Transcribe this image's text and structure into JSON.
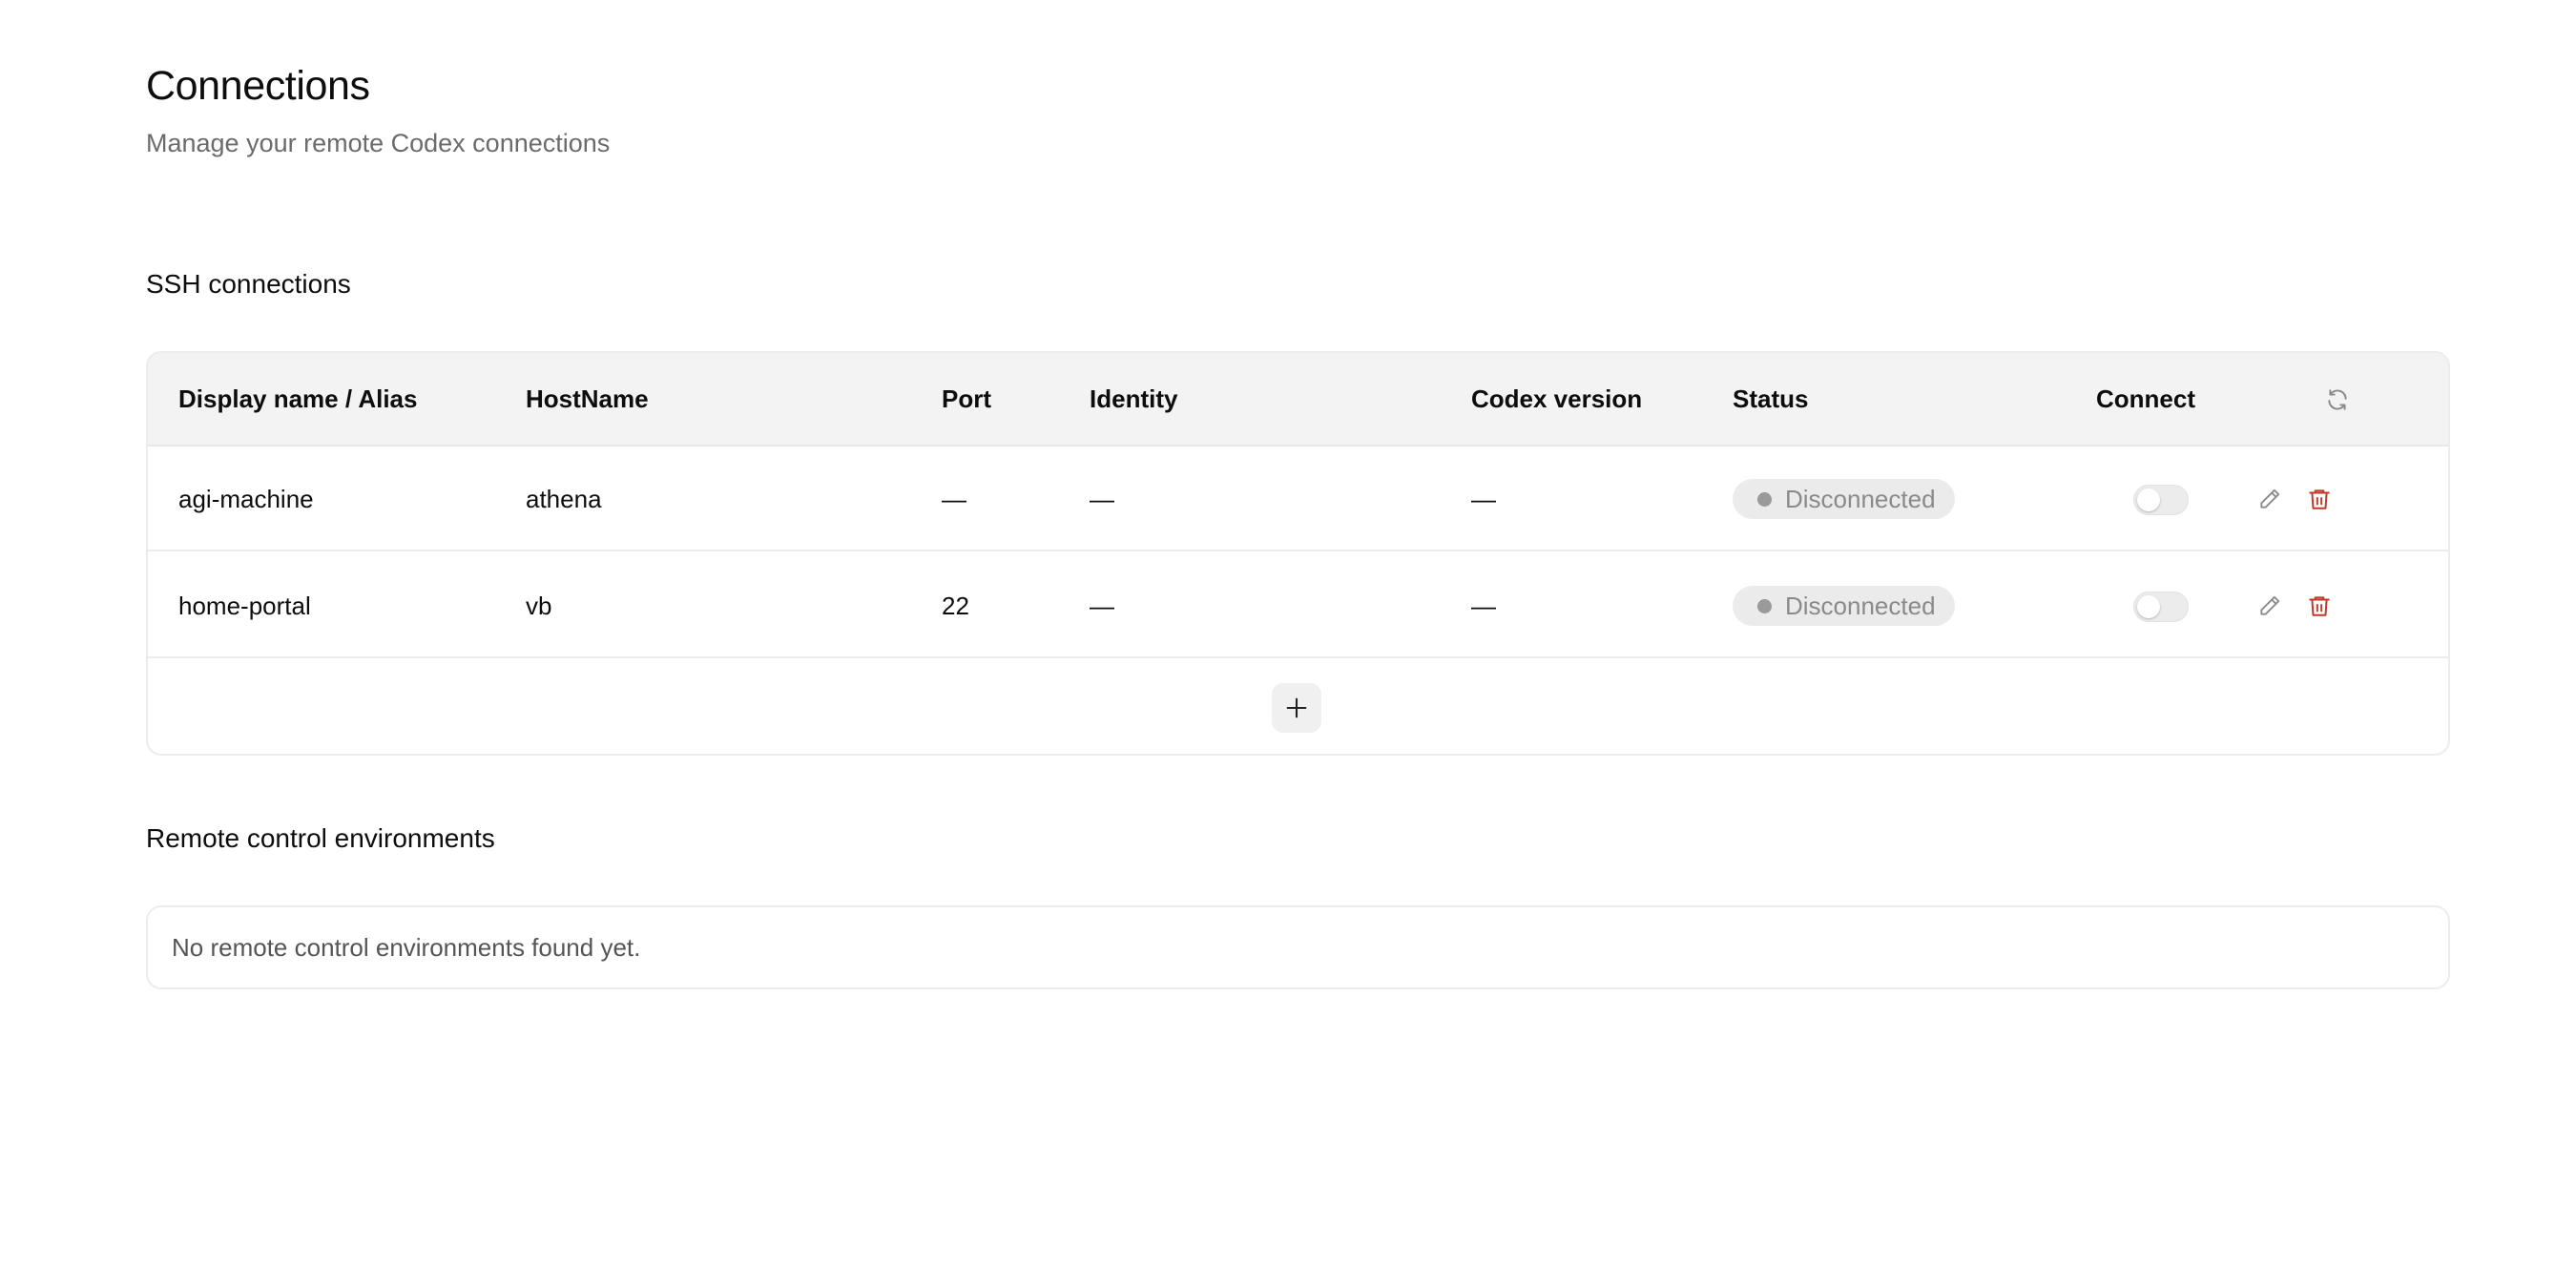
{
  "header": {
    "title": "Connections",
    "subtitle": "Manage your remote Codex connections"
  },
  "ssh": {
    "section_title": "SSH connections",
    "columns": {
      "name": "Display name / Alias",
      "host": "HostName",
      "port": "Port",
      "identity": "Identity",
      "codex_version": "Codex version",
      "status": "Status",
      "connect": "Connect"
    },
    "refresh_icon": "refresh-icon",
    "rows": [
      {
        "name": "agi-machine",
        "host": "athena",
        "port": "—",
        "identity": "—",
        "codex_version": "—",
        "status": "Disconnected",
        "connected": false
      },
      {
        "name": "home-portal",
        "host": "vb",
        "port": "22",
        "identity": "—",
        "codex_version": "—",
        "status": "Disconnected",
        "connected": false
      }
    ],
    "add_icon": "plus-icon"
  },
  "remote": {
    "section_title": "Remote control environments",
    "empty_message": "No remote control environments found yet."
  },
  "colors": {
    "delete_icon": "#c0392b",
    "status_pill_bg": "#ebebeb",
    "status_dot": "#9a9a9a",
    "header_bg": "#f3f3f3"
  }
}
